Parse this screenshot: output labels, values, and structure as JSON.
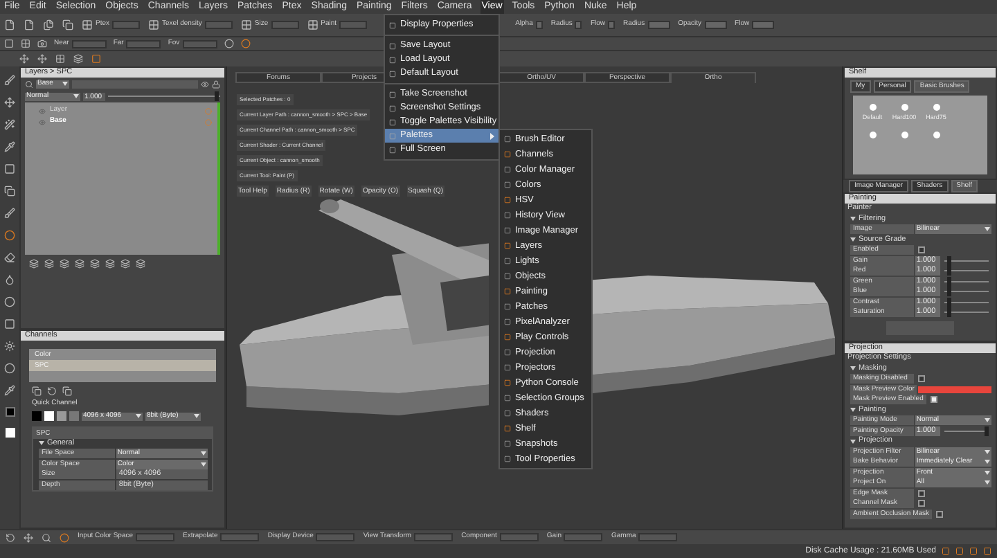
{
  "menu_bar": [
    {
      "label": "File",
      "selected": false
    },
    {
      "label": "Edit",
      "selected": false
    },
    {
      "label": "Selection",
      "selected": false
    },
    {
      "label": "Objects",
      "selected": false
    },
    {
      "label": "Channels",
      "selected": false
    },
    {
      "label": "Layers",
      "selected": false
    },
    {
      "label": "Patches",
      "selected": false
    },
    {
      "label": "Ptex",
      "selected": false
    },
    {
      "label": "Shading",
      "selected": false
    },
    {
      "label": "Painting",
      "selected": false
    },
    {
      "label": "Filters",
      "selected": false
    },
    {
      "label": "Camera",
      "selected": false
    },
    {
      "label": "View",
      "selected": true
    },
    {
      "label": "Tools",
      "selected": false
    },
    {
      "label": "Python",
      "selected": false
    },
    {
      "label": "Nuke",
      "selected": false
    },
    {
      "label": "Help",
      "selected": false
    }
  ],
  "toolbar": {
    "row_1": [
      "Ptex",
      "Texel density",
      "Size",
      "Paint"
    ],
    "row_1_right": [
      "Alpha",
      "Radius",
      "Flow",
      "Radius",
      "Opacity",
      "Flow"
    ],
    "row_2": [
      "Near",
      "Far",
      "Fov"
    ]
  },
  "view_menu": [
    {
      "label": "Display Properties",
      "selected": false,
      "separator_before": false
    },
    {
      "label": "Save Layout",
      "selected": false,
      "separator_before": true
    },
    {
      "label": "Load Layout",
      "selected": false,
      "separator_before": false
    },
    {
      "label": "Default Layout",
      "selected": false,
      "separator_before": false
    },
    {
      "label": "Take Screenshot",
      "selected": false,
      "separator_before": true
    },
    {
      "label": "Screenshot Settings",
      "selected": false,
      "separator_before": false
    },
    {
      "label": "Toggle Palettes Visibility",
      "selected": false,
      "separator_before": false
    },
    {
      "label": "Palettes",
      "selected": true,
      "separator_before": false
    },
    {
      "label": "Full Screen",
      "selected": false,
      "separator_before": false
    }
  ],
  "palettes_submenu": [
    "Brush Editor",
    "Channels",
    "Color Manager",
    "Colors",
    "HSV",
    "History View",
    "Image Manager",
    "Layers",
    "Lights",
    "Objects",
    "Painting",
    "Patches",
    "PixelAnalyzer",
    "Play Controls",
    "Projection",
    "Projectors",
    "Python Console",
    "Selection Groups",
    "Shaders",
    "Shelf",
    "Snapshots",
    "Tool Properties"
  ],
  "layers_panel": {
    "title": "Layers > SPC",
    "filter": "Base",
    "blend_mode": "Normal",
    "opacity": "1.000",
    "opacity_slider": {
      "level": 0.97
    },
    "layers": [
      {
        "name": "Layer",
        "selected": false
      },
      {
        "name": "Base",
        "selected": true
      }
    ]
  },
  "channels_panel": {
    "title": "Channels",
    "channels": [
      {
        "name": "Color",
        "selected": false
      },
      {
        "name": "SPC",
        "selected": true
      }
    ],
    "quick_channel": "Quick Channel",
    "size": "4096 x 4096",
    "depth": "8bit (Byte)",
    "section": "SPC",
    "rows": [
      {
        "kind": "section",
        "label": "General"
      },
      {
        "kind": "dropdown",
        "label": "File Space",
        "value": "Normal"
      },
      {
        "kind": "dropdown",
        "label": "Color Space",
        "value": "Color"
      },
      {
        "kind": "value",
        "label": "Size",
        "value": "4096 x 4096"
      },
      {
        "kind": "value",
        "label": "Depth",
        "value": "8bit (Byte)"
      }
    ]
  },
  "viewport": {
    "tabs": [
      {
        "label": "Forums",
        "selected": false
      },
      {
        "label": "Projects",
        "selected": false
      },
      {
        "label": "Ortho/UV",
        "selected": false
      },
      {
        "label": "Perspective",
        "selected": false
      },
      {
        "label": "Ortho",
        "selected": true
      }
    ],
    "info_lines": [
      "Selected Patches : 0",
      "Current Layer Path : cannon_smooth > SPC > Base",
      "Current Channel Path : cannon_smooth > SPC",
      "Current Shader : Current Channel",
      "Current Object : cannon_smooth",
      "Current Tool: Paint (P)"
    ],
    "tool_hints": [
      "Tool Help",
      "Radius (R)",
      "Rotate (W)",
      "Opacity (O)",
      "Squash (Q)"
    ]
  },
  "shelf": {
    "title": "Shelf",
    "tabs": [
      {
        "label": "My",
        "selected": false
      },
      {
        "label": "Personal",
        "selected": false
      },
      {
        "label": "Basic Brushes",
        "selected": true
      }
    ],
    "brushes": [
      "Default",
      "Hard100",
      "Hard75"
    ]
  },
  "side_tabs": [
    {
      "label": "Image Manager",
      "selected": false
    },
    {
      "label": "Shaders",
      "selected": false
    },
    {
      "label": "Shelf",
      "selected": true
    }
  ],
  "painting_panel": {
    "title": "Painting",
    "rows": [
      {
        "kind": "title",
        "label": "Painter"
      },
      {
        "kind": "section",
        "label": "Filtering"
      },
      {
        "kind": "dropdown",
        "label": "Image",
        "value": "Bilinear"
      },
      {
        "kind": "section",
        "label": "Source Grade"
      },
      {
        "kind": "checkbox",
        "label": "Enabled",
        "checked": false
      },
      {
        "kind": "slider",
        "label": "Gain",
        "value": "1.000",
        "level": 0.1
      },
      {
        "kind": "slider",
        "label": "Red",
        "value": "1.000",
        "level": 0.1
      },
      {
        "kind": "slider",
        "label": "Green",
        "value": "1.000",
        "level": 0.1
      },
      {
        "kind": "slider",
        "label": "Blue",
        "value": "1.000",
        "level": 0.1
      },
      {
        "kind": "slider",
        "label": "Contrast",
        "value": "1.000",
        "level": 0.1
      },
      {
        "kind": "slider",
        "label": "Saturation",
        "value": "1.000",
        "level": 0.1
      }
    ]
  },
  "projection_panel": {
    "title": "Projection",
    "rows": [
      {
        "kind": "title",
        "label": "Projection Settings"
      },
      {
        "kind": "section",
        "label": "Masking"
      },
      {
        "kind": "checkbox",
        "label": "Masking Disabled",
        "checked": false
      },
      {
        "kind": "color",
        "label": "Mask Preview Color",
        "color": "#e8453c"
      },
      {
        "kind": "checkbox",
        "label": "Mask Preview Enabled",
        "checked": true
      },
      {
        "kind": "section",
        "label": "Painting"
      },
      {
        "kind": "dropdown",
        "label": "Painting Mode",
        "value": "Normal"
      },
      {
        "kind": "slider",
        "label": "Painting Opacity",
        "value": "1.000",
        "level": 0.95
      },
      {
        "kind": "section",
        "label": "Projection"
      },
      {
        "kind": "dropdown",
        "label": "Projection Filter",
        "value": "Bilinear"
      },
      {
        "kind": "dropdown",
        "label": "Bake Behavior",
        "value": "Immediately Clear"
      },
      {
        "kind": "dropdown",
        "label": "Projection",
        "value": "Front"
      },
      {
        "kind": "dropdown",
        "label": "Project On",
        "value": "All"
      },
      {
        "kind": "checkbox",
        "label": "Edge Mask",
        "checked": false
      },
      {
        "kind": "checkbox",
        "label": "Channel Mask",
        "checked": false
      },
      {
        "kind": "checkbox",
        "label": "Ambient Occlusion Mask",
        "checked": false
      }
    ]
  },
  "bottom_bar": [
    "Input Color Space",
    "Extrapolate",
    "Display Device",
    "View Transform",
    "Component",
    "Gain",
    "Gamma"
  ],
  "status_bar": "Disk Cache Usage : 21.60MB Used"
}
